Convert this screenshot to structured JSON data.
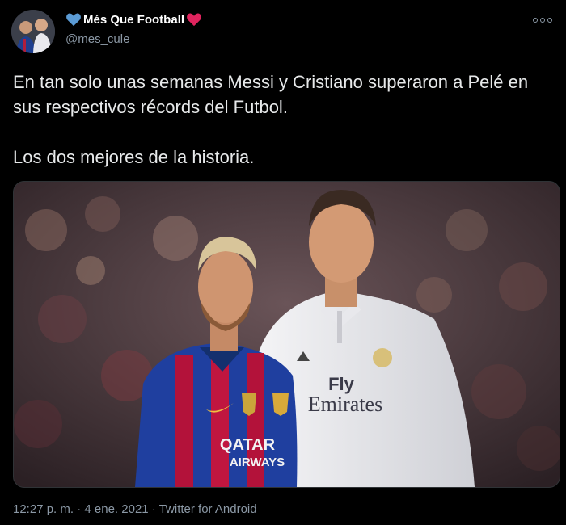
{
  "author": {
    "display_name": "Més Que Football",
    "handle": "@mes_cule",
    "heart_left_color": "#5b9bd5",
    "heart_right_color": "#e0245e"
  },
  "tweet": {
    "paragraph_1": "En tan solo unas semanas Messi y Cristiano superaron a Pelé en sus respectivos récords del Futbol.",
    "paragraph_2": "Los dos mejores de la historia."
  },
  "media": {
    "left_jersey_sponsor_line1": "QATAR",
    "left_jersey_sponsor_line2": "AIRWAYS",
    "right_jersey_sponsor_line1": "Fly",
    "right_jersey_sponsor_line2": "Emirates"
  },
  "footer": {
    "time": "12:27 p. m.",
    "separator": " · ",
    "date": "4 ene. 2021",
    "source": "Twitter for Android"
  },
  "icons": {
    "more": "more-options-icon",
    "heart_blue": "blue-heart-icon",
    "heart_red": "red-heart-icon"
  }
}
